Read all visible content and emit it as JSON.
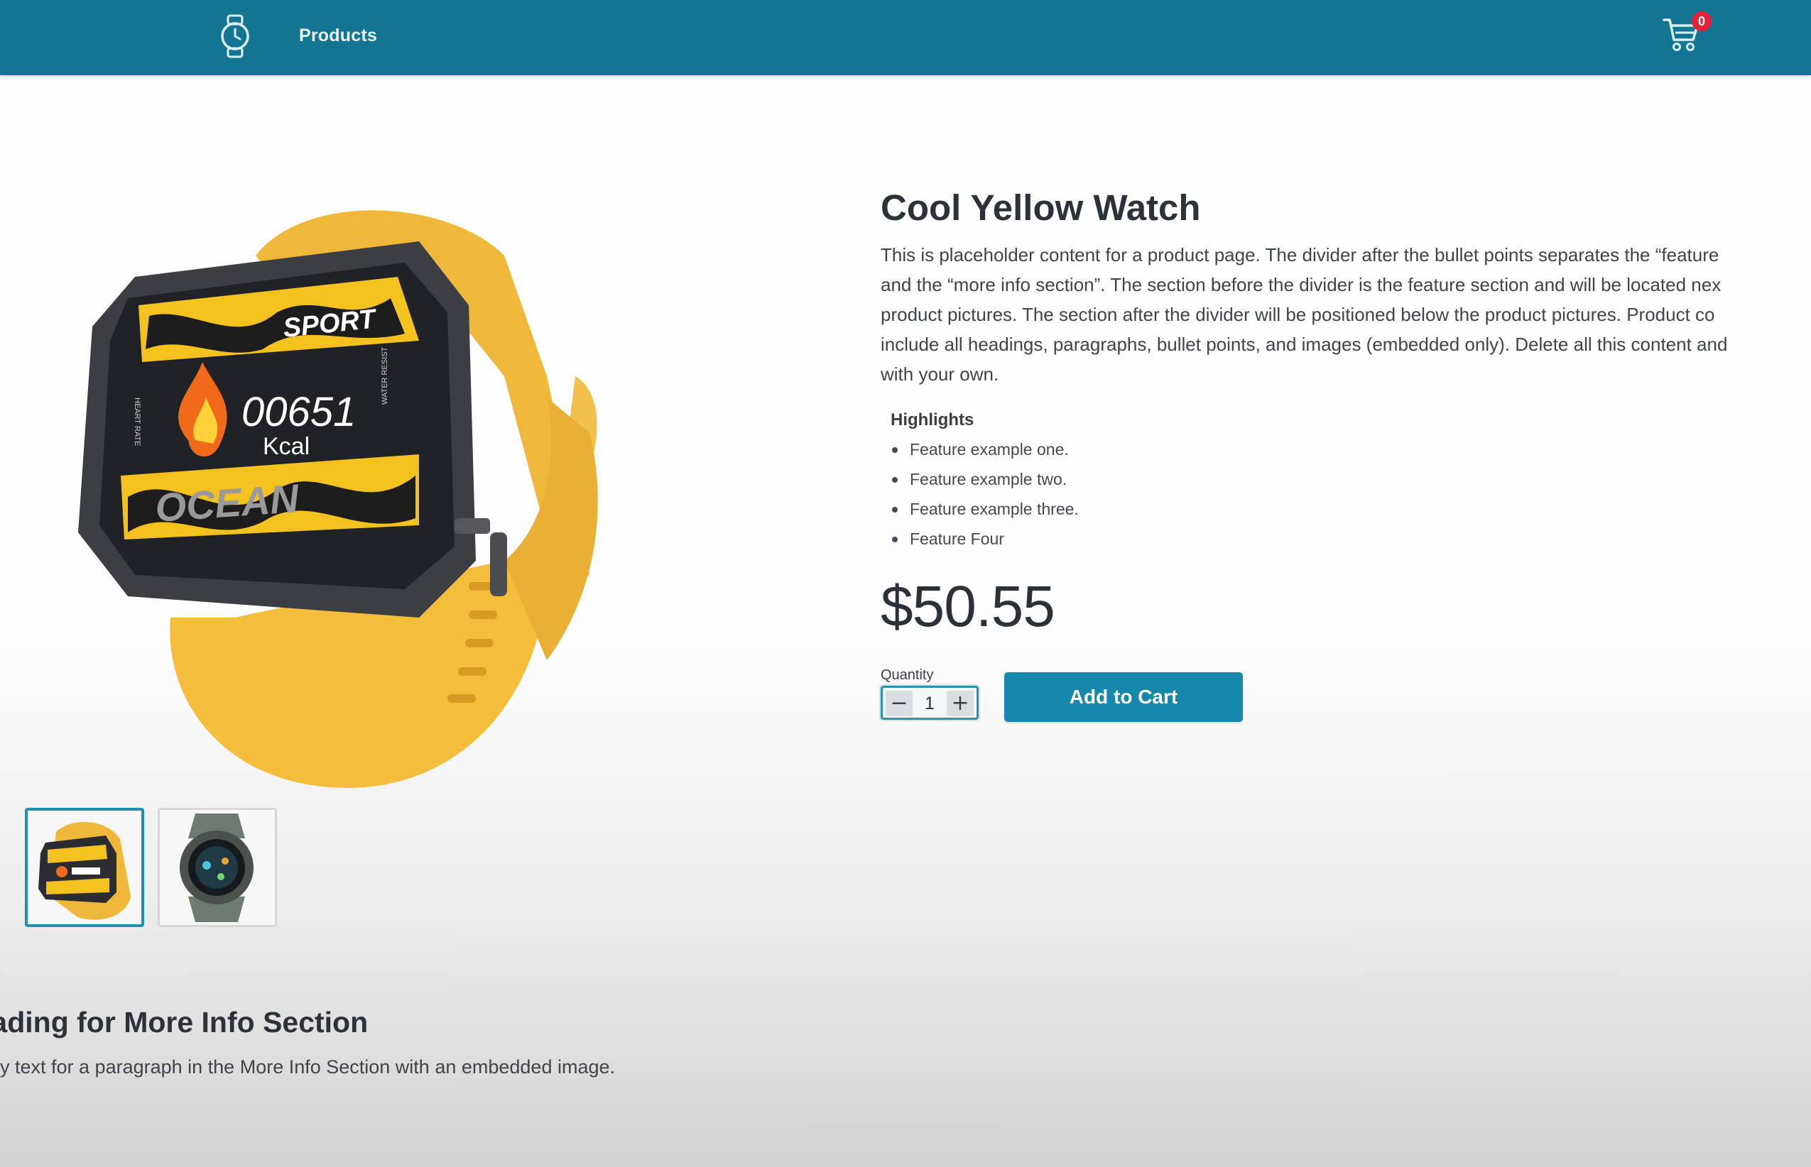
{
  "header": {
    "nav_products": "Products",
    "cart_count": "0",
    "brand_icon": "watch-icon",
    "cart_icon": "shopping-cart-icon",
    "background": "#137591"
  },
  "product": {
    "title": "Cool Yellow Watch",
    "description_lines": [
      "This is placeholder content for a product page. The divider after the bullet points separates the “feature",
      "and the “more info section”. The section before the divider is the feature section and will be located nex",
      "product pictures. The section after the divider will be positioned below the product pictures. Product co",
      "include all headings, paragraphs, bullet points, and images (embedded only). Delete all this content and",
      "with your own."
    ],
    "highlights_title": "Highlights",
    "features": [
      "Feature example one.",
      "Feature example two.",
      "Feature example three.",
      "Feature Four"
    ],
    "price": "$50.55",
    "quantity_label": "Quantity",
    "quantity_value": "1",
    "minus_symbol": "−",
    "plus_symbol": "+",
    "add_to_cart_label": "Add to Cart",
    "accent_color": "#1688ac"
  },
  "gallery": {
    "main_image": "yellow-sport-watch",
    "watch_face": {
      "top_text": "SPORT",
      "kcal_value": "00651",
      "kcal_unit": "Kcal",
      "bottom_text": "OCEAN",
      "side_left": "HEART RATE",
      "side_right": "WATER RESIST"
    },
    "thumbnails": [
      {
        "name": "yellow-watch-thumbnail",
        "selected": true
      },
      {
        "name": "gray-rugged-watch-thumbnail",
        "selected": false
      }
    ]
  },
  "more_info": {
    "heading": "le heading for More Info Section",
    "paragraph": "ummy text for a paragraph in the More Info Section with an embedded image."
  }
}
